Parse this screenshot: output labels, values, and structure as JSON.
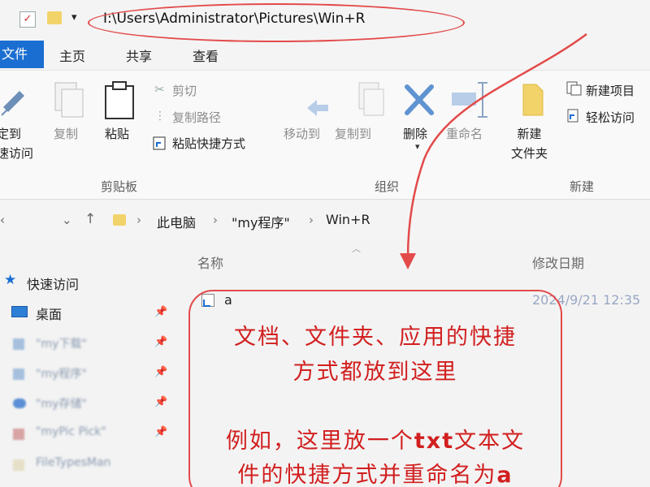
{
  "titlebar": {
    "path": "I:\\Users\\Administrator\\Pictures\\Win+R",
    "dropdown": "▾"
  },
  "tabs": {
    "file": "文件",
    "home": "主页",
    "share": "共享",
    "view": "查看"
  },
  "ribbon": {
    "clipboard": {
      "pin_line1": "定到",
      "pin_line2": "速访问",
      "copy": "复制",
      "paste": "粘贴",
      "cut": "剪切",
      "copy_path": "复制路径",
      "paste_shortcut": "粘贴快捷方式",
      "group": "剪贴板"
    },
    "organize": {
      "move_to": "移动到",
      "copy_to": "复制到",
      "delete": "删除",
      "rename": "重命名",
      "group": "组织"
    },
    "new": {
      "new_folder_line1": "新建",
      "new_folder_line2": "文件夹",
      "new_item": "新建项目",
      "easy_access": "轻松访问",
      "group": "新建"
    }
  },
  "address": {
    "crumbs": [
      "此电脑",
      "\"my程序\"",
      "Win+R"
    ]
  },
  "columns": {
    "name": "名称",
    "modified": "修改日期"
  },
  "nav_pane": {
    "quick_access": "快速访问",
    "desktop": "桌面",
    "items": [
      "\"my下载\"",
      "\"my程序\"",
      "\"my存储\"",
      "\"myPic Pick\"",
      "FileTypesMan"
    ]
  },
  "files": [
    {
      "name": "a",
      "modified": "2024/9/21 12:35"
    }
  ],
  "annotation": {
    "line1": "文档、文件夹、应用的快捷",
    "line2": "方式都放到这里",
    "line3_pre": "例如，这里放一个",
    "line3_bold": "txt",
    "line3_post": "文本文",
    "line4_pre": "件的快捷方式并重命名为",
    "line4_bold": "a"
  },
  "colors": {
    "accent": "#1b6ed1",
    "annotation": "#e34a4a"
  }
}
